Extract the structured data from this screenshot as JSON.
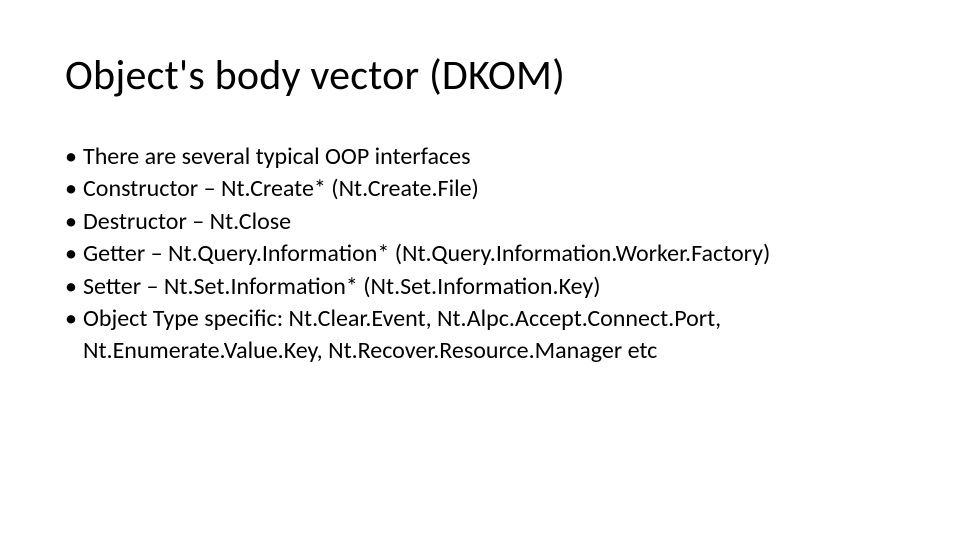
{
  "slide": {
    "title": "Object's body vector (DKOM)",
    "bullets": [
      {
        "text": "There are several typical OOP interfaces"
      },
      {
        "text": "Constructor – Nt.Create* (Nt.Create.File)"
      },
      {
        "text": "Destructor – Nt.Close"
      },
      {
        "text": "Getter – Nt.Query.Information* (Nt.Query.Information.Worker.Factory)"
      },
      {
        "text": "Setter – Nt.Set.Information* (Nt.Set.Information.Key)"
      },
      {
        "text": "Object Type specific: Nt.Clear.Event, Nt.Alpc.Accept.Connect.Port, Nt.Enumerate.Value.Key, Nt.Recover.Resource.Manager etc"
      }
    ],
    "bullet_glyph": "•"
  }
}
